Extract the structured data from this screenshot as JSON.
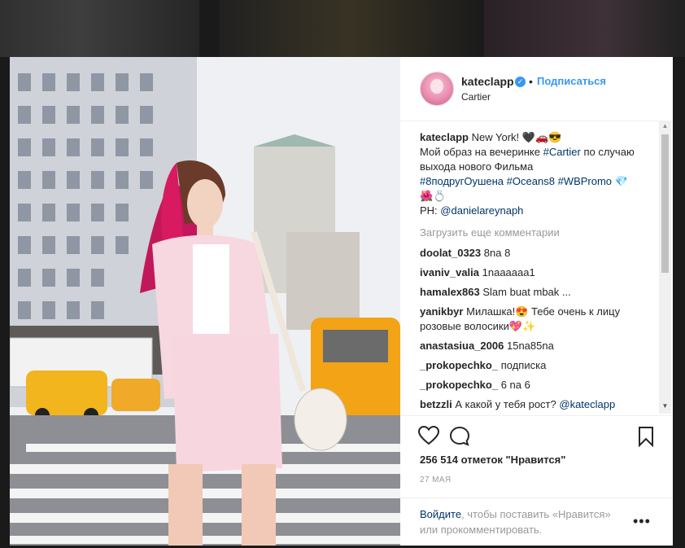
{
  "post": {
    "username": "kateclapp",
    "verified": true,
    "follow_label": "Подписаться",
    "separator": "•",
    "location": "Cartier"
  },
  "caption": {
    "username": "kateclapp",
    "text_1": "New York! 🖤🚗😎",
    "text_2": "Мой образ на вечеринке",
    "tag_cartier": "#Cartier",
    "text_3": "по случаю выхода нового Фильма",
    "tag_1": "#8подругОушена",
    "tag_2": "#Oceans8",
    "tag_3": "#WBPromo",
    "emoji_tail": "💎 🌺💍",
    "credit_prefix": "PH:",
    "credit_handle": "@danielareynaph"
  },
  "load_more": "Загрузить еще комментарии",
  "comments": [
    {
      "user": "doolat_0323",
      "text": "8na 8"
    },
    {
      "user": "ivaniv_valia",
      "text": "1naaaaaa1"
    },
    {
      "user": "hamalex863",
      "text": "Slam buat mbak ..."
    },
    {
      "user": "yanikbyr",
      "text": "Милашка!😍 Тебе очень к лицу розовые волосики💖✨"
    },
    {
      "user": "anastasiua_2006",
      "text": "15na85na"
    },
    {
      "user": "_prokopechko_",
      "text": "подписка"
    },
    {
      "user": "_prokopechko_",
      "text": "6 na 6"
    },
    {
      "user": "betzzli",
      "text": "А какой у тебя рост?",
      "mention": "@kateclapp"
    }
  ],
  "likes": "256 514 отметок \"Нравится\"",
  "date": "27 МАЯ",
  "login": {
    "link": "Войдите",
    "text": ", чтобы поставить «Нравится» или прокомментировать."
  },
  "more_label": "•••",
  "icons": [
    "verified-badge-icon",
    "heart-icon",
    "comment-icon",
    "bookmark-icon",
    "more-options-icon"
  ],
  "colors": {
    "accent": "#3897f0",
    "link": "#003569",
    "muted": "#999999",
    "text": "#262626"
  }
}
